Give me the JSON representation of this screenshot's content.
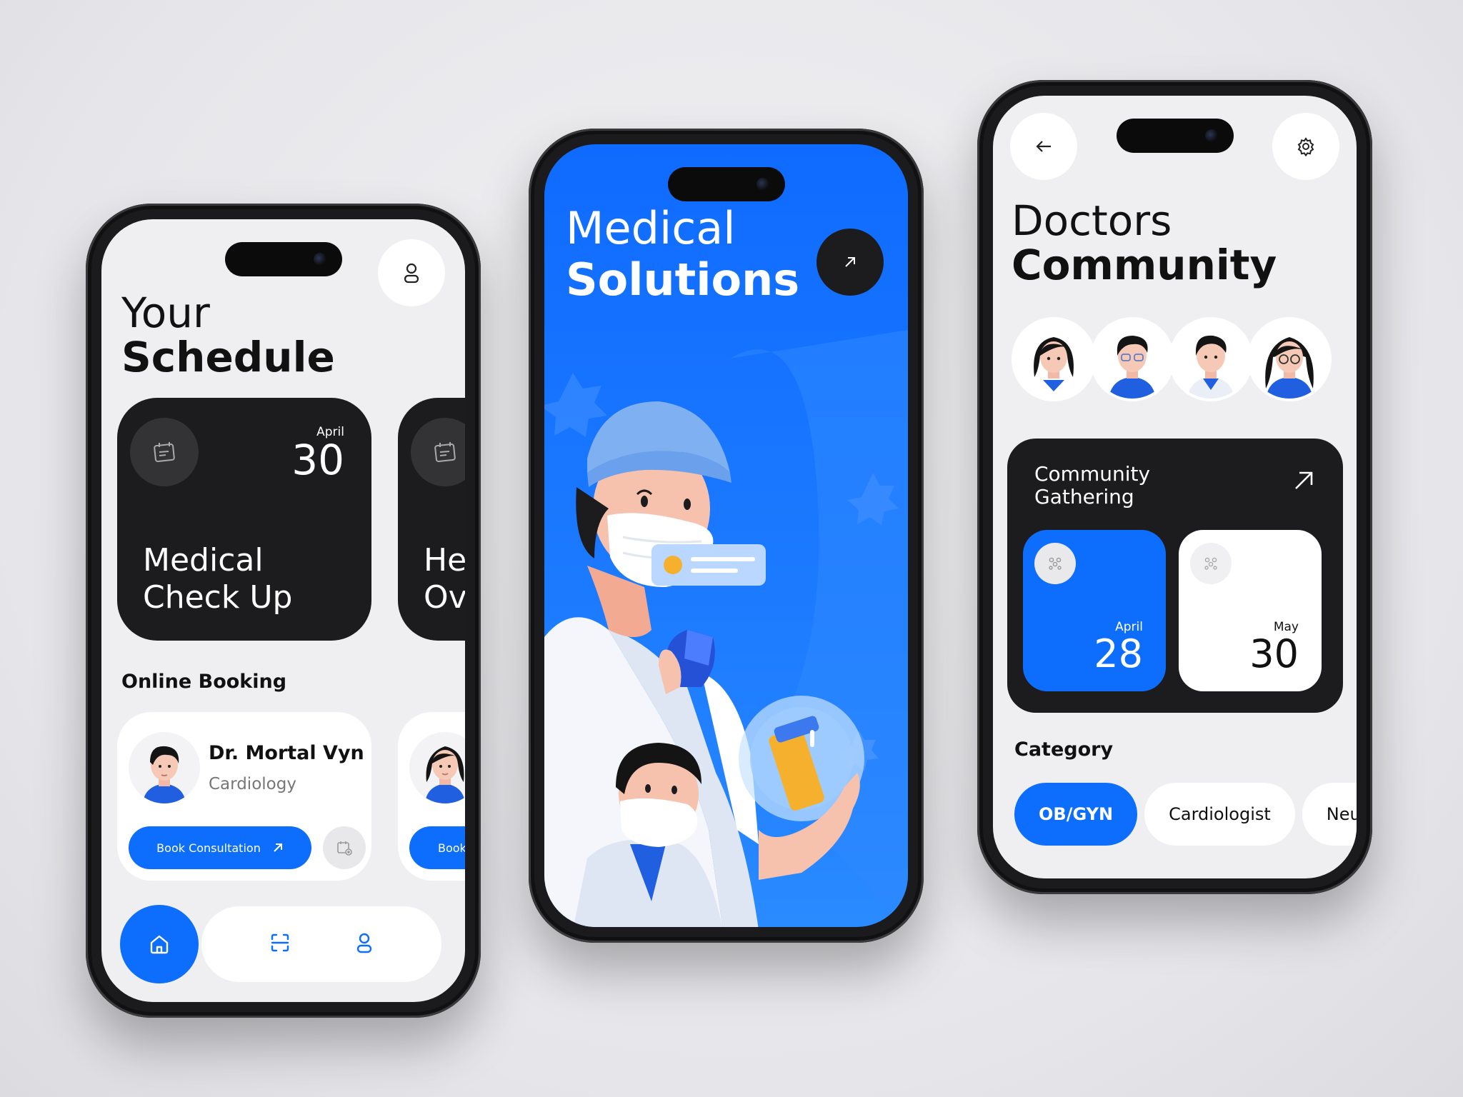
{
  "left_screen": {
    "title_line1": "Your",
    "title_line2": "Schedule",
    "appointment_cards": [
      {
        "month": "April",
        "day": "30",
        "title_line1": "Medical",
        "title_line2": "Check Up"
      },
      {
        "month": "",
        "day": "",
        "title_line1": "Hea",
        "title_line2": "Ove"
      }
    ],
    "section_label": "Online Booking",
    "doctor_cards": [
      {
        "name": "Dr. Mortal Vyn",
        "specialty": "Cardiology",
        "button_label": "Book Consultation"
      },
      {
        "name": "",
        "specialty": "",
        "button_label": "Book C"
      }
    ],
    "icons": {
      "profile": "user-icon",
      "calendar": "calendar-icon",
      "home": "home-icon",
      "scan": "scan-icon",
      "user": "user-icon"
    }
  },
  "middle_screen": {
    "title_line1": "Medical",
    "title_line2": "Solutions",
    "icons": {
      "cta": "arrow-up-right-icon"
    }
  },
  "right_screen": {
    "title_line1": "Doctors",
    "title_line2": "Community",
    "gathering": {
      "title_line1": "Community",
      "title_line2": "Gathering",
      "dates": [
        {
          "month": "April",
          "day": "28"
        },
        {
          "month": "May",
          "day": "30"
        }
      ]
    },
    "category_label": "Category",
    "categories": [
      "OB/GYN",
      "Cardiologist",
      "Neurol"
    ],
    "icons": {
      "back": "arrow-left-icon",
      "settings": "gear-icon",
      "group": "group-icon"
    }
  },
  "colors": {
    "accent": "#0D6EFD",
    "dark": "#1C1C1E",
    "surface": "#EFEFF1"
  }
}
